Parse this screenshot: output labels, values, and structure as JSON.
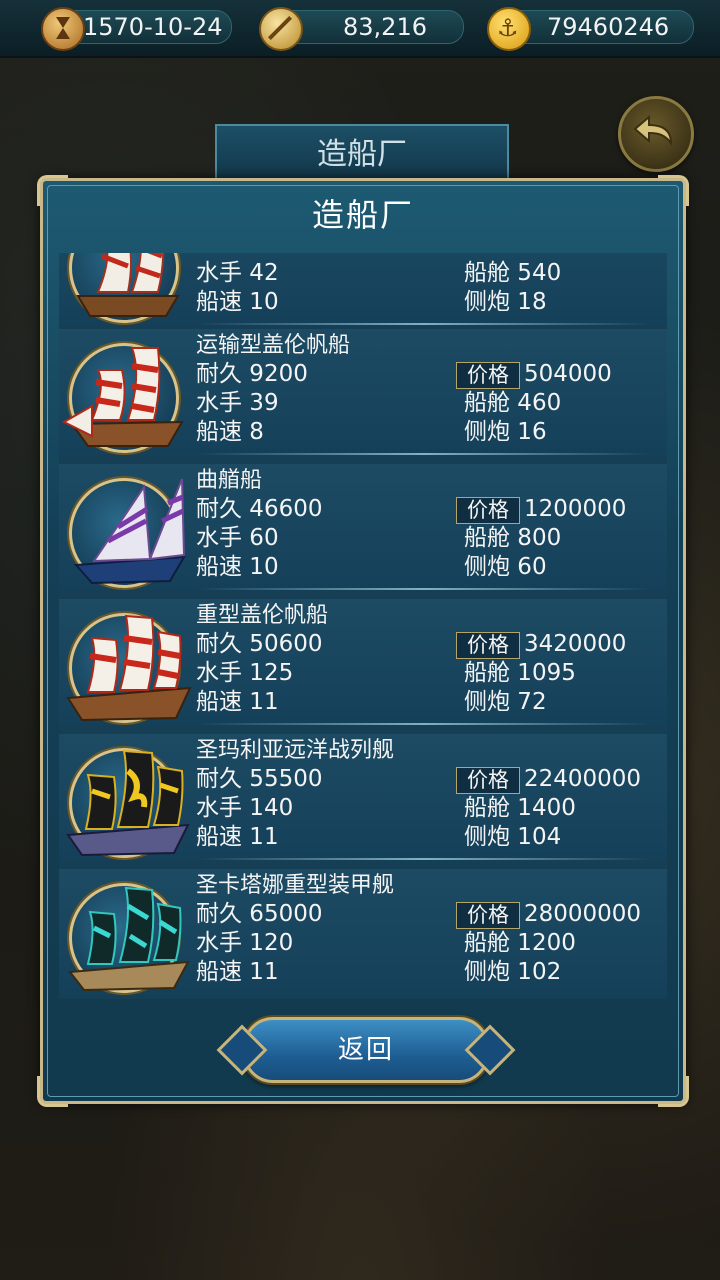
{
  "topbar": {
    "date": "1570-10-24",
    "compass_value": "83,216",
    "gold": "79460246"
  },
  "background_tab": "造船厂",
  "dialog": {
    "title": "造船厂",
    "return_label": "返回",
    "price_label": "价格"
  },
  "ships": [
    {
      "name": "",
      "durability": "",
      "sailors": "水手 42",
      "speed": "船速 10",
      "price": "",
      "cabin": "船舱 540",
      "cannons": "侧炮 18"
    },
    {
      "name": "运输型盖伦帆船",
      "durability": "耐久 9200",
      "sailors": "水手 39",
      "speed": "船速 8",
      "price": "504000",
      "cabin": "船舱 460",
      "cannons": "侧炮 16"
    },
    {
      "name": "曲艏船",
      "durability": "耐久 46600",
      "sailors": "水手 60",
      "speed": "船速 10",
      "price": "1200000",
      "cabin": "船舱 800",
      "cannons": "侧炮 60"
    },
    {
      "name": "重型盖伦帆船",
      "durability": "耐久 50600",
      "sailors": "水手 125",
      "speed": "船速 11",
      "price": "3420000",
      "cabin": "船舱 1095",
      "cannons": "侧炮 72"
    },
    {
      "name": "圣玛利亚远洋战列舰",
      "durability": "耐久 55500",
      "sailors": "水手 140",
      "speed": "船速 11",
      "price": "22400000",
      "cabin": "船舱 1400",
      "cannons": "侧炮 104"
    },
    {
      "name": "圣卡塔娜重型装甲舰",
      "durability": "耐久 65000",
      "sailors": "水手 120",
      "speed": "船速 11",
      "price": "28000000",
      "cabin": "船舱 1200",
      "cannons": "侧炮 102"
    }
  ],
  "icons": {
    "date": "hourglass-icon",
    "compass": "compass-icon",
    "gold": "anchor-coin-icon",
    "back": "back-arrow-icon"
  },
  "colors": {
    "panel": "#15405a",
    "border_gold": "#c9b98a",
    "button_blue": "#1e5e93"
  }
}
